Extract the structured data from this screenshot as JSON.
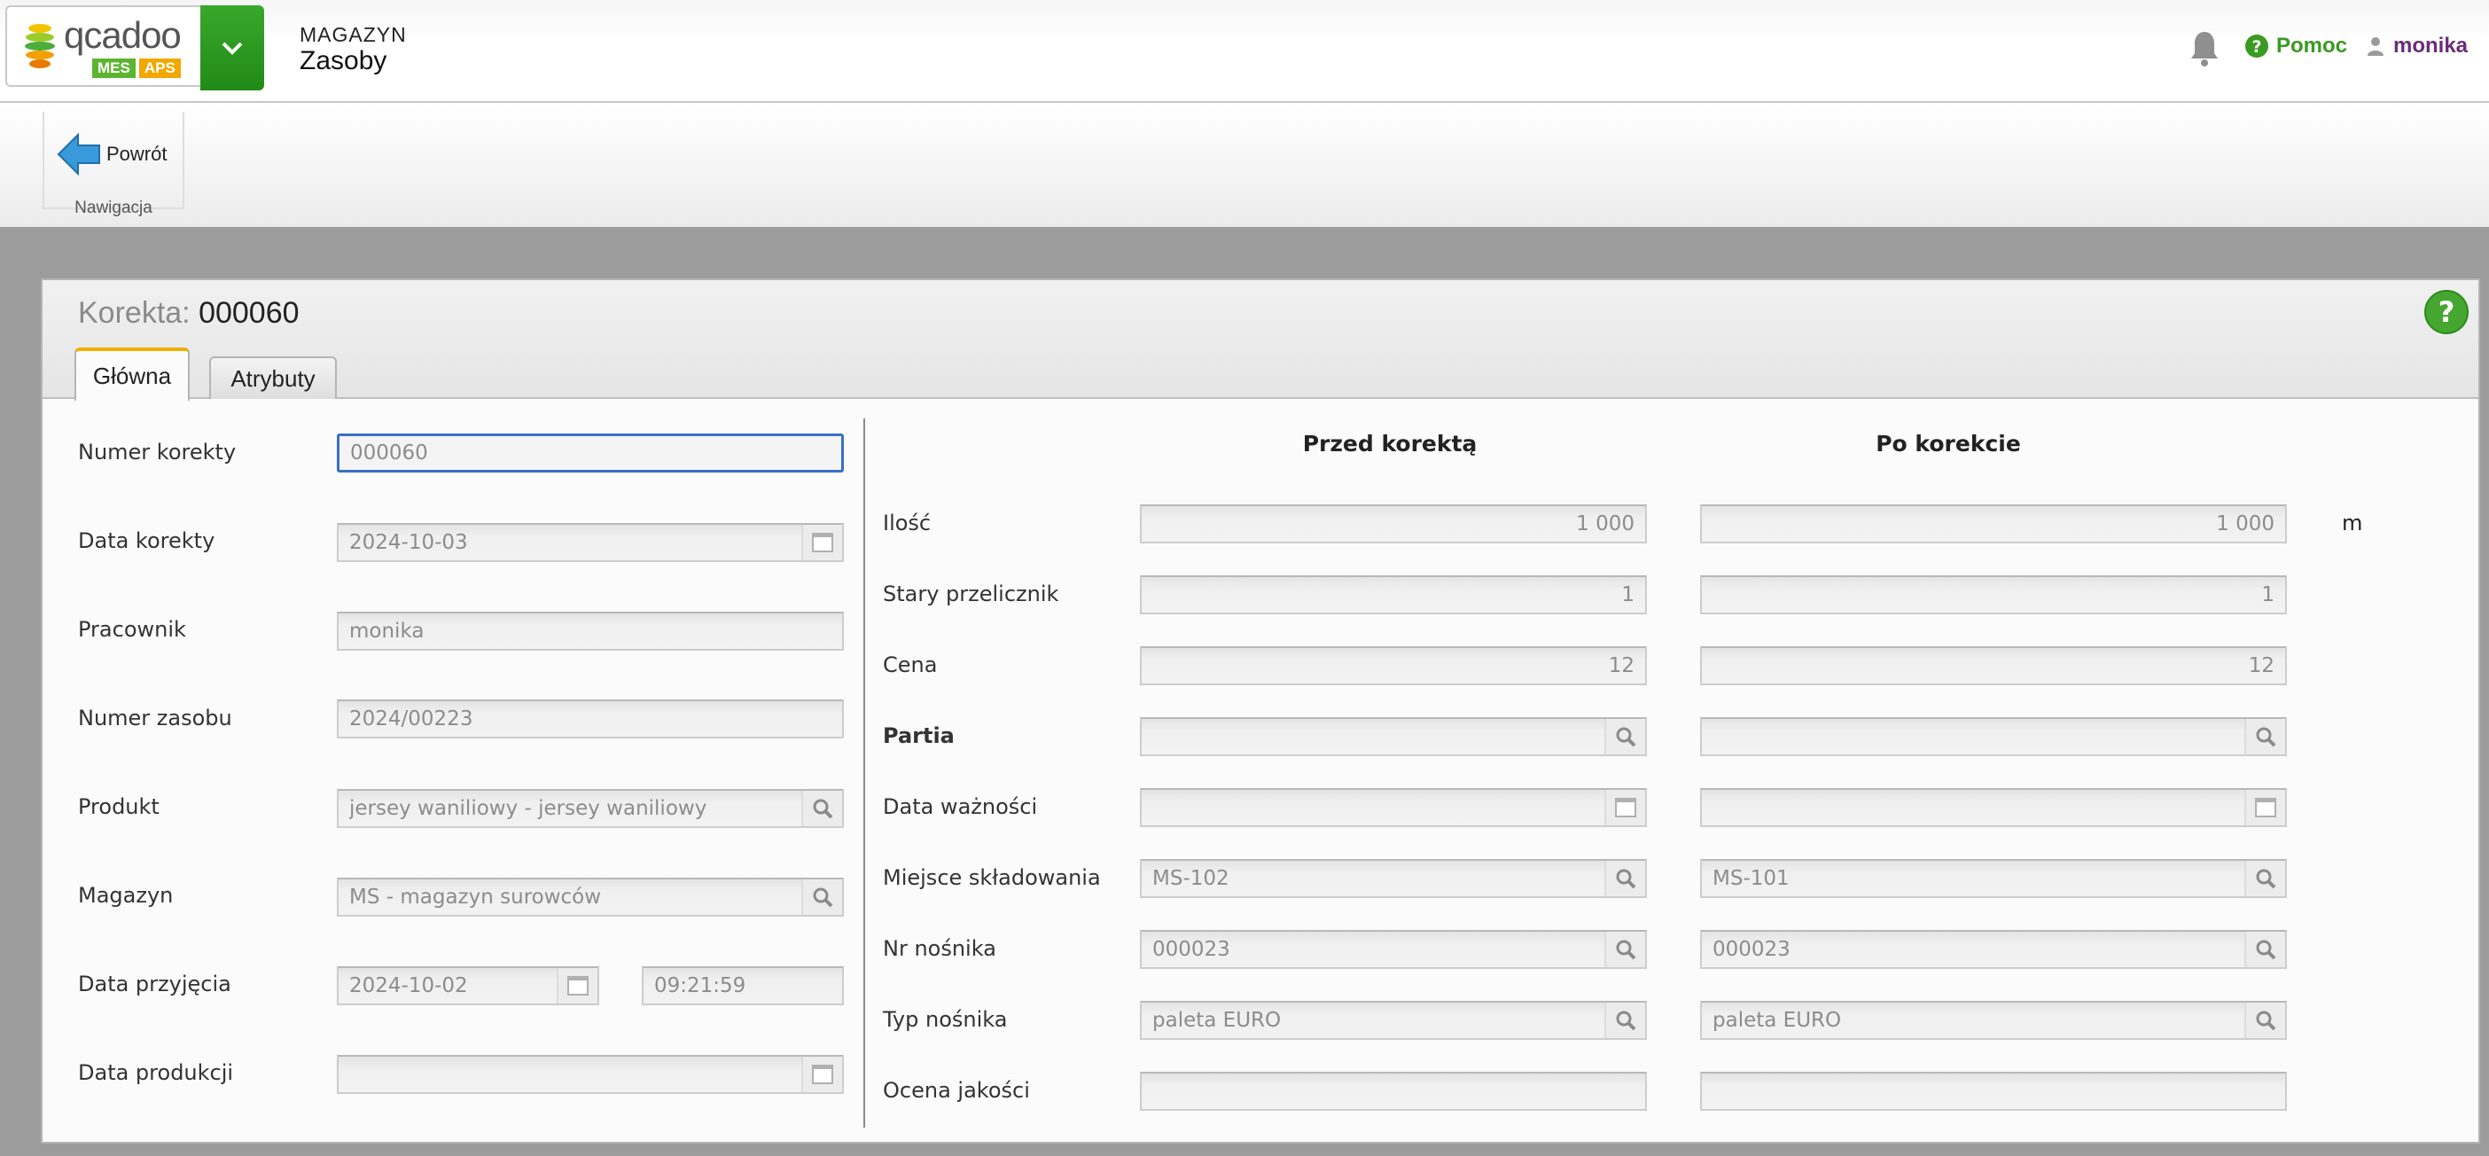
{
  "header": {
    "logo_text": "qcadoo",
    "logo_badge_mes": "MES",
    "logo_badge_aps": "APS",
    "module": "MAGAZYN",
    "page": "Zasoby",
    "help": "Pomoc",
    "user": "monika"
  },
  "ribbon": {
    "back": "Powrót",
    "group_label": "Nawigacja"
  },
  "panel": {
    "title_label": "Korekta:",
    "title_value": "000060",
    "tabs": [
      "Główna",
      "Atrybuty"
    ]
  },
  "left": {
    "fields": [
      {
        "label": "Numer korekty",
        "value": "000060"
      },
      {
        "label": "Data korekty",
        "value": "2024-10-03"
      },
      {
        "label": "Pracownik",
        "value": "monika"
      },
      {
        "label": "Numer zasobu",
        "value": "2024/00223"
      },
      {
        "label": "Produkt",
        "value": "jersey waniliowy - jersey waniliowy"
      },
      {
        "label": "Magazyn",
        "value": "MS - magazyn surowców"
      },
      {
        "label": "Data przyjęcia",
        "value": "2024-10-02",
        "time": "09:21:59"
      },
      {
        "label": "Data produkcji",
        "value": ""
      }
    ]
  },
  "right": {
    "col_before": "Przed korektą",
    "col_after": "Po korekcie",
    "unit": "m",
    "rows": [
      {
        "label": "Ilość",
        "before": "1 000",
        "after": "1 000"
      },
      {
        "label": "Stary przelicznik",
        "before": "1",
        "after": "1"
      },
      {
        "label": "Cena",
        "before": "12",
        "after": "12"
      },
      {
        "label": "Partia",
        "before": "",
        "after": ""
      },
      {
        "label": "Data ważności",
        "before": "",
        "after": ""
      },
      {
        "label": "Miejsce składowania",
        "before": "MS-102",
        "after": "MS-101"
      },
      {
        "label": "Nr nośnika",
        "before": "000023",
        "after": "000023"
      },
      {
        "label": "Typ nośnika",
        "before": "paleta EURO",
        "after": "paleta EURO"
      },
      {
        "label": "Ocena jakości",
        "before": "",
        "after": ""
      }
    ]
  },
  "colors": {
    "accent_green": "#2e9a1f",
    "focus_blue": "#3a6fc8",
    "tab_active": "#f0b000",
    "user": "#6a2c7a"
  }
}
